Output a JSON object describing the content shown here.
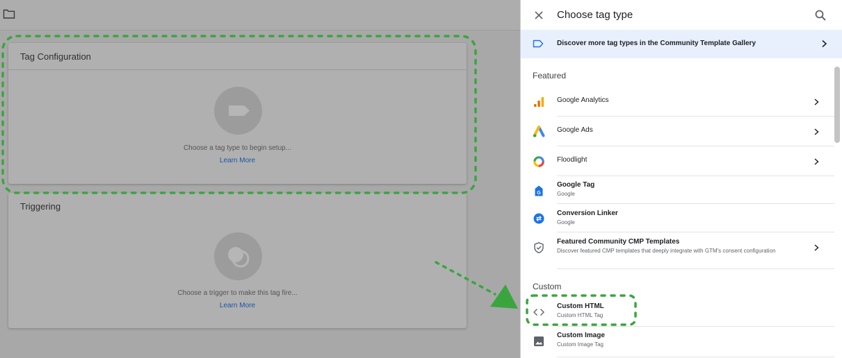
{
  "editor": {
    "tag_card": {
      "title": "Tag Configuration",
      "placeholder": "Choose a tag type to begin setup...",
      "link": "Learn More"
    },
    "trigger_card": {
      "title": "Triggering",
      "placeholder": "Choose a trigger to make this tag fire...",
      "link": "Learn More"
    }
  },
  "panel": {
    "title": "Choose tag type",
    "banner": "Discover more tag types in the Community Template Gallery",
    "sections": {
      "featured": "Featured",
      "custom": "Custom"
    },
    "featured_items": [
      {
        "name": "Google Analytics",
        "icon": "google-analytics-icon"
      },
      {
        "name": "Google Ads",
        "icon": "google-ads-icon"
      },
      {
        "name": "Floodlight",
        "icon": "floodlight-icon"
      },
      {
        "name": "Google Tag",
        "sub": "Google",
        "icon": "google-tag-icon"
      },
      {
        "name": "Conversion Linker",
        "sub": "Google",
        "icon": "conversion-linker-icon"
      },
      {
        "name": "Featured Community CMP Templates",
        "sub": "Discover featured CMP templates that deeply integrate with GTM's consent configuration",
        "icon": "shield-icon"
      }
    ],
    "custom_items": [
      {
        "name": "Custom HTML",
        "sub": "Custom HTML Tag",
        "icon": "code-icon"
      },
      {
        "name": "Custom Image",
        "sub": "Custom Image Tag",
        "icon": "image-icon"
      }
    ]
  },
  "colors": {
    "annotation": "#3aa53f",
    "banner_bg": "#e8f0fe",
    "link": "#1a56a8"
  }
}
